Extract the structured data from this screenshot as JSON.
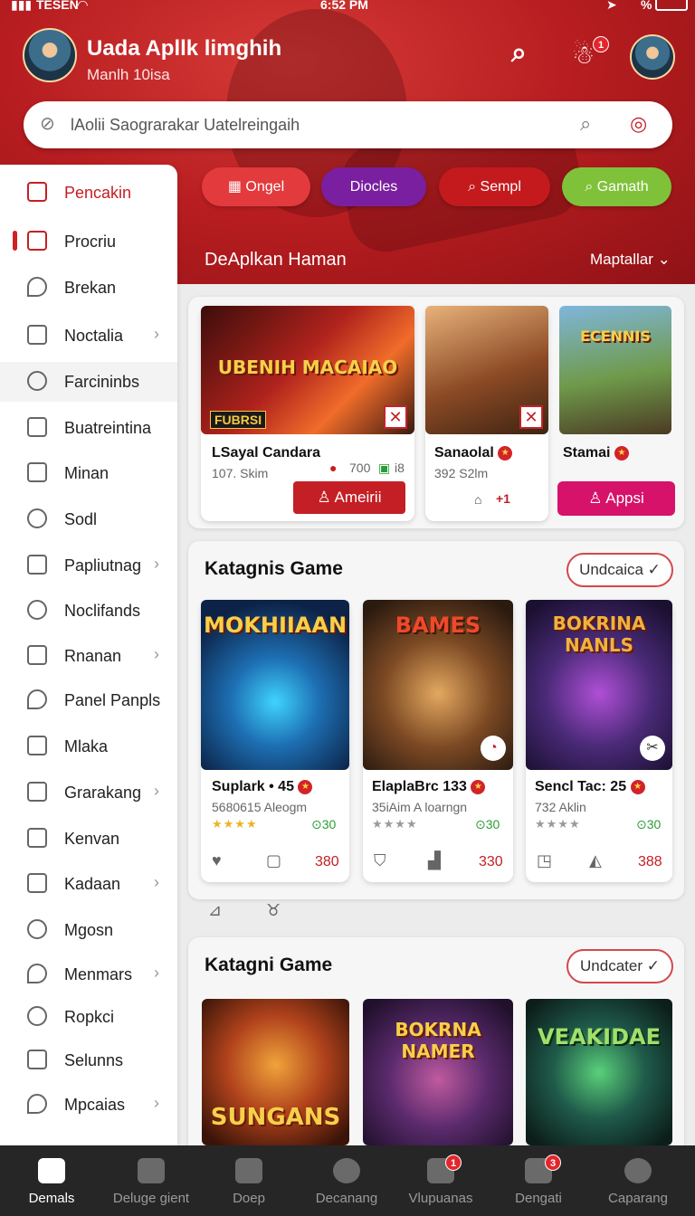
{
  "status": {
    "carrier": "TESEN",
    "time": "6:52 PM",
    "battery": "%"
  },
  "header": {
    "title": "Uada Apllk limghih",
    "subtitle": "Manlh 10isa",
    "notif_count": "1"
  },
  "search": {
    "placeholder": "lAolii Saograrakar Uatelreingaih"
  },
  "filters": [
    {
      "label": "Ongel",
      "color": "#e33a3d"
    },
    {
      "label": "Diocles",
      "color": "#7a1fa0"
    },
    {
      "label": "Sempl",
      "color": "#c41a1e"
    },
    {
      "label": "Gamath",
      "color": "#7fc23a"
    }
  ],
  "section": {
    "title": "DeAplkan Haman",
    "sort_label": "Maptallar"
  },
  "sidebar": {
    "items": [
      {
        "label": "Pencakin"
      },
      {
        "label": "Procriu"
      },
      {
        "label": "Brekan"
      },
      {
        "label": "Noctalia"
      },
      {
        "label": "Farcininbs"
      },
      {
        "label": "Buatreintina"
      },
      {
        "label": "Minan"
      },
      {
        "label": "Sodl"
      },
      {
        "label": "Papliutnag"
      },
      {
        "label": "Noclifands"
      },
      {
        "label": "Rnanan"
      },
      {
        "label": "Panel Panpls"
      },
      {
        "label": "Mlaka"
      },
      {
        "label": "Grarakang"
      },
      {
        "label": "Kenvan"
      },
      {
        "label": "Kadaan"
      },
      {
        "label": "Mgosn"
      },
      {
        "label": "Menmars"
      },
      {
        "label": "Ropkci"
      },
      {
        "label": "Selunns"
      },
      {
        "label": "Mpcaias"
      }
    ]
  },
  "featured": [
    {
      "banner": "UBENIH MACAIAO",
      "tag": "FUBRSI",
      "name": "LSayal Candara",
      "sub": "107. Skim",
      "stat1": "700",
      "stat2": "i8",
      "button": "Ameirii"
    },
    {
      "name": "Sanaolal",
      "sub": "392 S2lm",
      "count": "+1"
    },
    {
      "banner": "ECENNIS",
      "name": "Stamai",
      "button": "Appsi"
    }
  ],
  "panel1": {
    "title": "Katagnis Game",
    "button": "Undcaica",
    "games": [
      {
        "banner": "MOKHIIAAN",
        "name": "Suplark • 45",
        "sub": "5680615 Aleogm",
        "score": "30",
        "num": "380"
      },
      {
        "banner": "BAMES",
        "name": "ElaplaBrc 133",
        "sub": "35iAim A loarngn",
        "score": "30",
        "num": "330"
      },
      {
        "banner": "BOKRINA NANLS",
        "name": "Sencl Tac: 25",
        "sub": "732 Aklin",
        "score": "30",
        "num": "388"
      }
    ]
  },
  "panel2": {
    "title": "Katagni Game",
    "button": "Undcater",
    "games": [
      {
        "banner": "SUNGANS"
      },
      {
        "banner": "BOKRNA NAMER"
      },
      {
        "banner": "VEAKIDAE"
      }
    ]
  },
  "nav": {
    "items": [
      {
        "label": "Demals"
      },
      {
        "label": "Deluge gient"
      },
      {
        "label": "Doep"
      },
      {
        "label": "Decanang"
      },
      {
        "label": "Vlupuanas",
        "badge": "1"
      },
      {
        "label": "Dengati",
        "badge": "3"
      },
      {
        "label": "Caparang"
      }
    ]
  }
}
